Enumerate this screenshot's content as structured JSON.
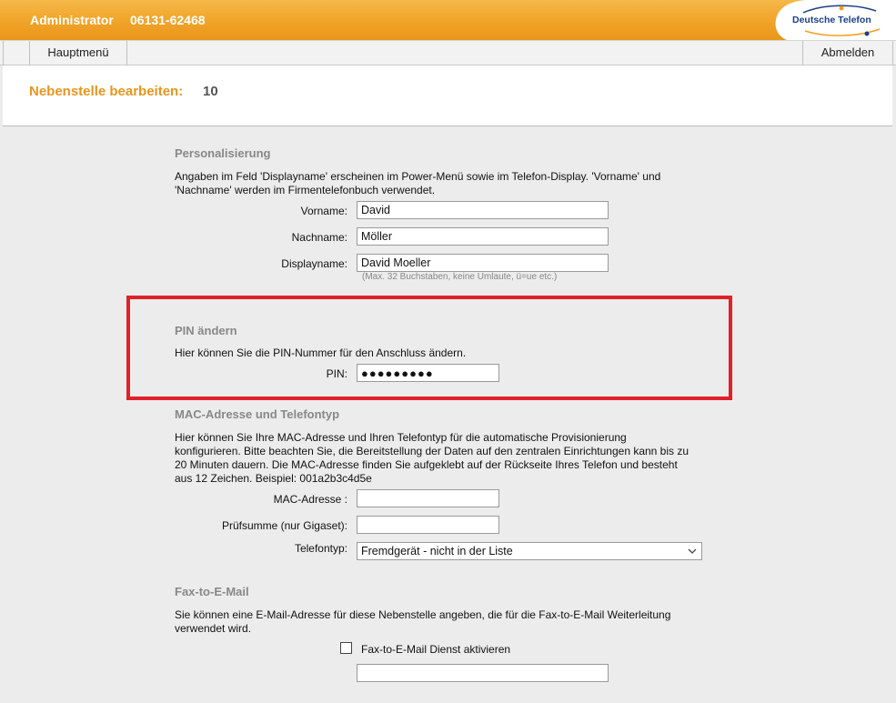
{
  "header": {
    "role": "Administrator",
    "phone": "06131-62468",
    "logo_text": "Deutsche Telefon"
  },
  "nav": {
    "home": "Hauptmenü",
    "logout": "Abmelden"
  },
  "page": {
    "title": "Nebenstelle bearbeiten:",
    "id": "10"
  },
  "personalization": {
    "title": "Personalisierung",
    "desc_line1": "Angaben im Feld 'Displayname' erscheinen im Power-Menü sowie im Telefon-Display. 'Vorname' und",
    "desc_line2": "'Nachname' werden im Firmentelefonbuch verwendet.",
    "firstname_label": "Vorname:",
    "firstname_value": "David",
    "lastname_label": "Nachname:",
    "lastname_value": "Möller",
    "displayname_label": "Displayname:",
    "displayname_value": "David Moeller",
    "displayname_hint": "(Max. 32 Buchstaben, keine Umlaute, ü=ue etc.)"
  },
  "pin": {
    "title": "PIN ändern",
    "desc": "Hier können Sie die PIN-Nummer für den Anschluss ändern.",
    "label": "PIN:",
    "masked_value": "●●●●●●●●●"
  },
  "mac": {
    "title": "MAC-Adresse und Telefontyp",
    "desc_line1": "Hier können Sie Ihre MAC-Adresse und Ihren Telefontyp für die automatische Provisionierung",
    "desc_line2": "konfigurieren. Bitte beachten Sie, die Bereitstellung der Daten auf den zentralen Einrichtungen kann bis zu",
    "desc_line3": "20 Minuten dauern. Die MAC-Adresse finden Sie aufgeklebt auf der Rückseite Ihres Telefon und besteht",
    "desc_line4": "aus 12 Zeichen. Beispiel: 001a2b3c4d5e",
    "mac_label": "MAC-Adresse :",
    "mac_value": "",
    "checksum_label": "Prüfsumme (nur Gigaset):",
    "checksum_value": "",
    "phone_type_label": "Telefontyp:",
    "phone_type_selected": "Fremdgerät - nicht in der Liste"
  },
  "fax": {
    "title": "Fax-to-E-Mail",
    "desc_line1": "Sie können eine E-Mail-Adresse für diese Nebenstelle angeben, die für die Fax-to-E-Mail Weiterleitung",
    "desc_line2": "verwendet wird.",
    "checkbox_label": "Fax-to-E-Mail Dienst aktivieren",
    "email_value": ""
  },
  "colors": {
    "accent_orange": "#e8951e",
    "highlight_red": "#e0202a",
    "logo_blue": "#1a3f8a"
  }
}
